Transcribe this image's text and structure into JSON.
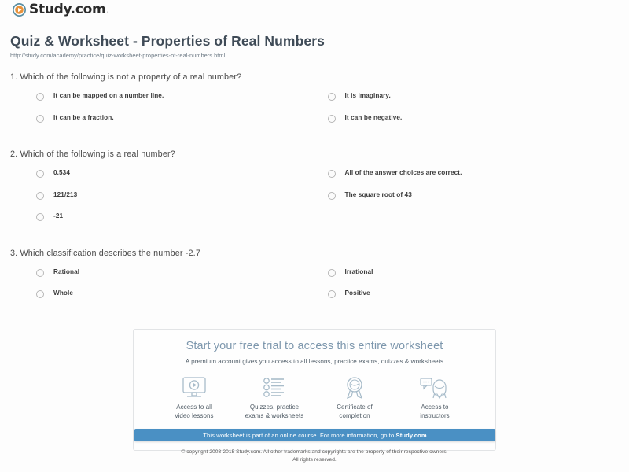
{
  "brand": {
    "name": "Study.com",
    "trademark": "·",
    "logo_icon": "play-circle-icon",
    "accent_color": "#e8923a",
    "mark_color": "#5b8fa3"
  },
  "header": {
    "title": "Quiz & Worksheet - Properties of Real Numbers",
    "url": "http://study.com/academy/practice/quiz-worksheet-properties-of-real-numbers.html"
  },
  "questions": [
    {
      "number": "1.",
      "text": "1. Which of the following is not a property of a real number?",
      "options": [
        "It can be mapped on a number line.",
        "It is imaginary.",
        "It can be a fraction.",
        "It can be negative."
      ]
    },
    {
      "number": "2.",
      "text": "2. Which of the following is a real number?",
      "options": [
        "0.534",
        "All of the answer choices are correct.",
        "121/213",
        "The square root of 43",
        "-21"
      ]
    },
    {
      "number": "3.",
      "text": "3. Which classification describes the number -2.7",
      "options": [
        "Rational",
        "Irrational",
        "Whole",
        "Positive"
      ]
    }
  ],
  "promo": {
    "title": "Start your free trial to access this entire worksheet",
    "subtitle": "A premium account gives you access to all lessons, practice exams, quizzes & worksheets",
    "features": [
      {
        "icon": "monitor-play-icon",
        "label": "Access to all\nvideo lessons"
      },
      {
        "icon": "checklist-icon",
        "label": "Quizzes, practice\nexams & worksheets"
      },
      {
        "icon": "award-ribbon-icon",
        "label": "Certificate of\ncompletion"
      },
      {
        "icon": "instructor-chat-icon",
        "label": "Access to\ninstructors"
      }
    ],
    "feature_labels": [
      [
        "Access to all",
        "video lessons"
      ],
      [
        "Quizzes, practice",
        "exams & worksheets"
      ],
      [
        "Certificate of",
        "completion"
      ],
      [
        "Access to",
        "instructors"
      ]
    ]
  },
  "course_bar": {
    "text_prefix": "This worksheet is part of an online course. For more information, go to ",
    "link_text": "Study.com",
    "background_color": "#4a90c4"
  },
  "footer": {
    "line1": "© copyright 2003-2015 Study.com. All other trademarks and copyrights are the property of their respective owners.",
    "line2": "All rights reserved."
  }
}
